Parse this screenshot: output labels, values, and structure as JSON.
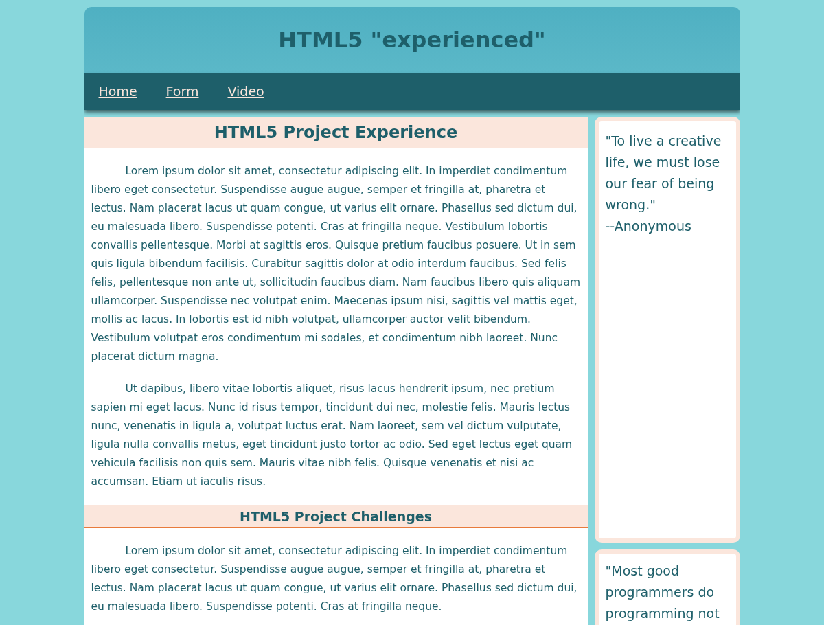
{
  "header": {
    "title": "HTML5 \"experienced\""
  },
  "nav": [
    {
      "label": "Home"
    },
    {
      "label": "Form"
    },
    {
      "label": "Video"
    }
  ],
  "sections": [
    {
      "heading": "HTML5 Project Experience",
      "kind": "main",
      "paragraphs": [
        "Lorem ipsum dolor sit amet, consectetur adipiscing elit. In imperdiet condimentum libero eget consectetur. Suspendisse augue augue, semper et fringilla at, pharetra et lectus. Nam placerat lacus ut quam congue, ut varius elit ornare. Phasellus sed dictum dui, eu malesuada libero. Suspendisse potenti. Cras at fringilla neque. Vestibulum lobortis convallis pellentesque. Morbi at sagittis eros. Quisque pretium faucibus posuere. Ut in sem quis ligula bibendum facilisis. Curabitur sagittis dolor at odio interdum faucibus. Sed felis felis, pellentesque non ante ut, sollicitudin faucibus diam. Nam faucibus libero quis aliquam ullamcorper. Suspendisse nec volutpat enim. Maecenas ipsum nisi, sagittis vel mattis eget, mollis ac lacus. In lobortis est id nibh volutpat, ullamcorper auctor velit bibendum. Vestibulum volutpat eros condimentum mi sodales, et condimentum nibh laoreet. Nunc placerat dictum magna.",
        "Ut dapibus, libero vitae lobortis aliquet, risus lacus hendrerit ipsum, nec pretium sapien mi eget lacus. Nunc id risus tempor, tincidunt dui nec, molestie felis. Mauris lectus nunc, venenatis in ligula a, volutpat luctus erat. Nam laoreet, sem vel dictum vulputate, ligula nulla convallis metus, eget tincidunt justo tortor ac odio. Sed eget lectus eget quam vehicula facilisis non quis sem. Mauris vitae nibh felis. Quisque venenatis et nisi ac accumsan. Etiam ut iaculis risus."
      ]
    },
    {
      "heading": "HTML5 Project Challenges",
      "kind": "sub",
      "paragraphs": [
        "Lorem ipsum dolor sit amet, consectetur adipiscing elit. In imperdiet condimentum libero eget consectetur. Suspendisse augue augue, semper et fringilla at, pharetra et lectus. Nam placerat lacus ut quam congue, ut varius elit ornare. Phasellus sed dictum dui, eu malesuada libero. Suspendisse potenti. Cras at fringilla neque."
      ]
    }
  ],
  "quotes": [
    {
      "text": "\"To live a creative life, we must lose our fear of being wrong.\"",
      "author": "--Anonymous"
    },
    {
      "text": "\"Most good programmers do programming not"
    }
  ]
}
